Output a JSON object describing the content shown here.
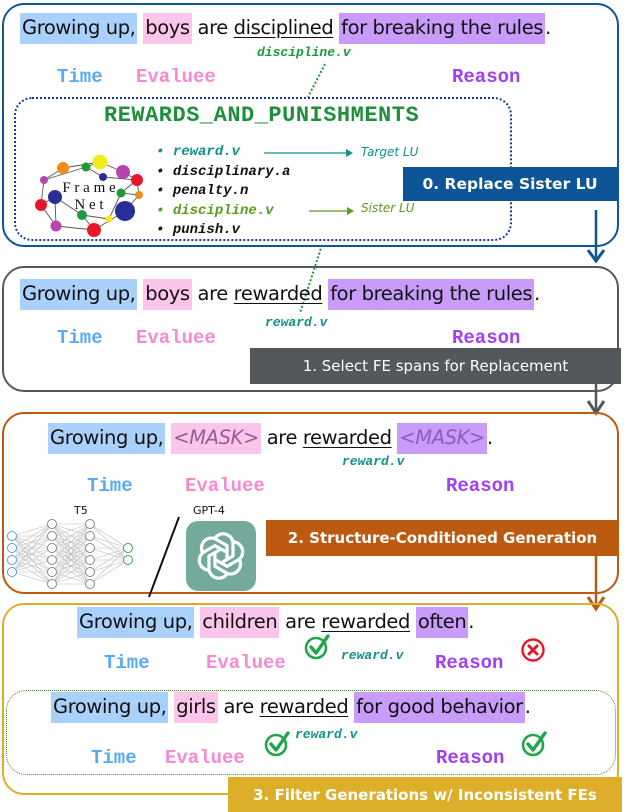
{
  "colors": {
    "step0": "#0d5596",
    "step1": "#54575c",
    "step2": "#bb5a10",
    "step3": "#dcae2a",
    "time": "#5aa9f5",
    "evaluee": "#f58ad0",
    "reason": "#a040f0",
    "teal_lu": "#138f8a",
    "green_lu": "#1a9a3a",
    "frame_title": "#1e8f3a",
    "check": "#1fa64a",
    "cross": "#e5182b"
  },
  "panel0": {
    "sentence": {
      "time": "Growing up,",
      "evaluee": "boys",
      "mid": "are",
      "target": "disciplined",
      "reason": "for breaking the rules",
      "end": "."
    },
    "lu": "discipline.v",
    "fe_labels": {
      "time": "Time",
      "evaluee": "Evaluee",
      "reason": "Reason"
    },
    "frame": {
      "title": "REWARDS_AND_PUNISHMENTS",
      "logo_text": [
        "F r a m e",
        "N e t"
      ],
      "lus": [
        {
          "text": "reward.v",
          "style": "teal",
          "note": "Target LU"
        },
        {
          "text": "disciplinary.a",
          "style": "black",
          "note": ""
        },
        {
          "text": "penalty.n",
          "style": "black",
          "note": ""
        },
        {
          "text": "discipline.v",
          "style": "green",
          "note": "Sister LU"
        },
        {
          "text": "punish.v",
          "style": "black",
          "note": ""
        }
      ]
    },
    "step_label": "0. Replace Sister LU"
  },
  "panel1": {
    "sentence": {
      "time": "Growing up,",
      "evaluee": "boys",
      "mid": "are",
      "target": "rewarded",
      "reason": "for breaking the rules",
      "end": "."
    },
    "lu": "reward.v",
    "fe_labels": {
      "time": "Time",
      "evaluee": "Evaluee",
      "reason": "Reason"
    },
    "step_label": "1. Select FE spans for Replacement"
  },
  "panel2": {
    "sentence": {
      "time": "Growing up,",
      "evaluee": "<MASK>",
      "mid": "are",
      "target": "rewarded",
      "reason": "<MASK>",
      "end": "."
    },
    "lu": "reward.v",
    "fe_labels": {
      "time": "Time",
      "evaluee": "Evaluee",
      "reason": "Reason"
    },
    "models": {
      "left": "T5",
      "right": "GPT-4"
    },
    "step_label": "2. Structure-Conditioned Generation"
  },
  "panel3": {
    "gen1": {
      "sentence": {
        "time": "Growing up,",
        "evaluee": "children",
        "mid": "are",
        "target": "rewarded",
        "reason": "often",
        "end": "."
      },
      "lu": "reward.v",
      "fe_labels": {
        "time": "Time",
        "evaluee": "Evaluee",
        "reason": "Reason"
      },
      "evaluee_status": "consistent",
      "reason_status": "inconsistent"
    },
    "gen2": {
      "sentence": {
        "time": "Growing up,",
        "evaluee": "girls",
        "mid": "are",
        "target": "rewarded",
        "reason": "for good behavior",
        "end": "."
      },
      "lu": "reward.v",
      "fe_labels": {
        "time": "Time",
        "evaluee": "Evaluee",
        "reason": "Reason"
      },
      "evaluee_status": "consistent",
      "reason_status": "consistent"
    },
    "step_label": "3. Filter Generations w/ Inconsistent FEs"
  }
}
